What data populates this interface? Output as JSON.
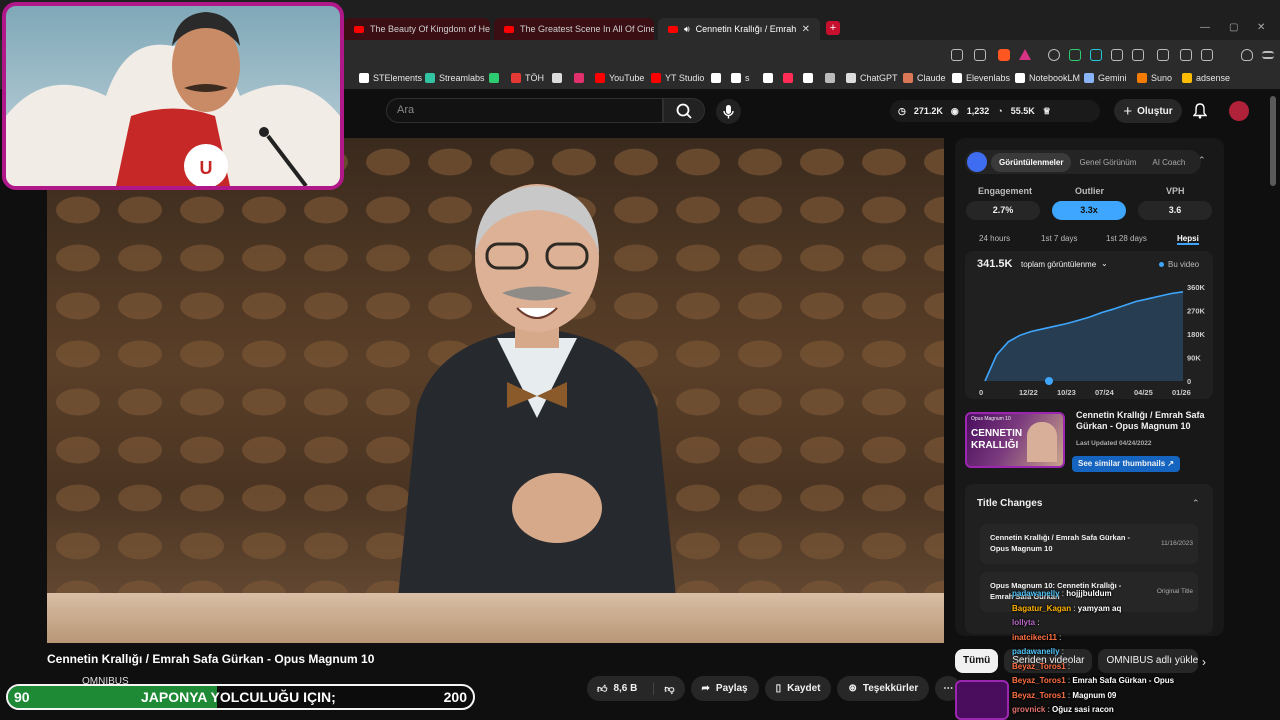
{
  "browser": {
    "tabs": [
      {
        "title": "The Beauty Of Kingdom of Heaven -"
      },
      {
        "title": "The Greatest Scene In All Of Cinema"
      },
      {
        "title": "Cennetin Krallığı / Emrah Safa"
      }
    ],
    "tab_close": "✕",
    "new_tab": "+"
  },
  "bookmarks": [
    {
      "label": "STElements",
      "color": "#ffffff"
    },
    {
      "label": "Streamlabs",
      "color": "#31c3a2"
    },
    {
      "label": "",
      "color": "#2ecc71"
    },
    {
      "label": "TÖH",
      "color": "#e53935"
    },
    {
      "label": "",
      "color": "#dddddd"
    },
    {
      "label": "",
      "color": "#e1306c"
    },
    {
      "label": "YouTube",
      "color": "#ff0000"
    },
    {
      "label": "YT Studio",
      "color": "#ff0000"
    },
    {
      "label": "",
      "color": "#ffffff"
    },
    {
      "label": "s",
      "color": "#ffffff"
    },
    {
      "label": "",
      "color": "#ffffff"
    },
    {
      "label": "",
      "color": "#ff2d55"
    },
    {
      "label": "",
      "color": "#ffffff"
    },
    {
      "label": "",
      "color": "#bbbbbb"
    },
    {
      "label": "ChatGPT",
      "color": "#dddddd"
    },
    {
      "label": "Claude",
      "color": "#d97757"
    },
    {
      "label": "Elevenlabs",
      "color": "#ffffff"
    },
    {
      "label": "NotebookLM",
      "color": "#ffffff"
    },
    {
      "label": "Gemini",
      "color": "#8ab4f8"
    },
    {
      "label": "Suno",
      "color": "#f57c00"
    },
    {
      "label": "adsense",
      "color": "#fbbc04"
    }
  ],
  "youtube_header": {
    "search_placeholder": "Ara",
    "stat_views": "271.2K",
    "stat_videos": "1,232",
    "stat_subs": "55.5K",
    "create_label": "Oluştur"
  },
  "video": {
    "title": "Cennetin Krallığı / Emrah Safa Gürkan - Opus Magnum 10",
    "channel": "OMNIBUS",
    "likes": "8,6 B",
    "share": "Paylaş",
    "save": "Kaydet",
    "thanks": "Teşekkürler",
    "more": "⋯"
  },
  "overlay_bar": {
    "left_value": "90",
    "text": "JAPONYA YOLCULUĞU IÇIN;",
    "right_value": "200",
    "progress": 0.45
  },
  "panel": {
    "tabs": [
      "Görüntülenmeler",
      "Genel Görünüm",
      "AI Coach"
    ],
    "active_tab": 0,
    "metrics": [
      {
        "label": "Engagement",
        "value": "2.7%"
      },
      {
        "label": "Outlier",
        "value": "3.3x"
      },
      {
        "label": "VPH",
        "value": "3.6"
      }
    ],
    "ranges": [
      "24 hours",
      "1st 7 days",
      "1st 28 days",
      "Hepsi"
    ],
    "total_views": "341.5K",
    "total_label": "toplam görüntülenme",
    "legend": "Bu video",
    "thumb_title": "Cennetin Krallığı / Emrah Safa Gürkan - Opus Magnum 10",
    "thumb_updated": "Last Updated 04/24/2022",
    "thumb_line1": "CENNETIN",
    "thumb_line2": "KRALLIĞI",
    "thumb_tag": "Opus Magnum 10",
    "similar_btn": "See similar thumbnails",
    "title_changes_header": "Title Changes",
    "title_changes": [
      {
        "title": "Cennetin Krallığı / Emrah Safa Gürkan - Opus Magnum 10",
        "date": "11/16/2023"
      },
      {
        "title": "Opus Magnum 10: Cennetin Krallığı - Emrah Safa Gürkan",
        "date": "Original Title"
      }
    ]
  },
  "chart_data": {
    "type": "area",
    "x_ticks": [
      "0",
      "12/22",
      "10/23",
      "07/24",
      "04/25",
      "01/26"
    ],
    "y_ticks": [
      "360K",
      "270K",
      "180K",
      "90K",
      "0"
    ],
    "ylim": [
      0,
      360000
    ],
    "series": [
      {
        "name": "Bu video",
        "values": [
          0,
          100000,
          150000,
          175000,
          190000,
          200000,
          210000,
          220000,
          232000,
          245000,
          262000,
          275000,
          290000,
          305000,
          315000,
          325000,
          335000,
          341500
        ]
      }
    ]
  },
  "chips": [
    "Tümü",
    "Seriden videolar",
    "OMNIBUS adlı yükle"
  ],
  "chat": [
    {
      "user": "padawanelly",
      "msg": "hojjjbuldum",
      "color": "#4fc3f7"
    },
    {
      "user": "Bagatur_Kagan",
      "msg": "yamyam aq",
      "color": "#ffb300"
    },
    {
      "user": "lollyta",
      "msg": "",
      "color": "#ba68c8"
    },
    {
      "user": "inatcikeci11",
      "msg": "",
      "color": "#ff7043"
    },
    {
      "user": "padawanelly",
      "msg": "",
      "color": "#4fc3f7"
    },
    {
      "user": "Beyaz_Toros1",
      "msg": "",
      "color": "#ff7043"
    },
    {
      "user": "Beyaz_Toros1",
      "msg": "Emrah Safa Gürkan - Opus",
      "color": "#ff7043"
    },
    {
      "user": "Beyaz_Toros1",
      "msg": "Magnum 09",
      "color": "#ff7043"
    },
    {
      "user": "grovnick",
      "msg": "Oğuz sasi racon",
      "color": "#e57373"
    }
  ]
}
